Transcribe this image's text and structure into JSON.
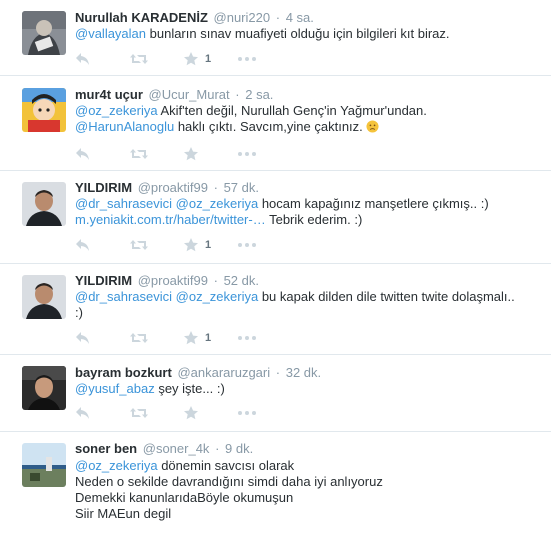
{
  "tweets": [
    {
      "fullname": "Nurullah KARADENİZ",
      "handle": "@nuri220",
      "time": "4 sa.",
      "mention1": "@vallayalan",
      "text1": " bunların sınav muafiyeti olduğu için bilgileri kıt biraz.",
      "retweet_count": "1"
    },
    {
      "fullname": "mur4t uçur",
      "handle": "@Ucur_Murat",
      "time": "2 sa.",
      "mention1": "@oz_zekeriya",
      "text1": " Akif'ten değil, Nurullah Genç'in Yağmur'undan.",
      "mention2": "@HarunAlanoglu",
      "text2": " haklı çıktı. Savcım,yine çaktınız. "
    },
    {
      "fullname": "YILDIRIM",
      "handle": "@proaktif99",
      "time": "57 dk.",
      "mention1": "@dr_sahrasevici",
      "mention2": "@oz_zekeriya",
      "text1": " hocam kapağınız manşetlere çıkmış.. :)",
      "link": "m.yeniakit.com.tr/haber/twitter-…",
      "text2": " Tebrik ederim. :)",
      "retweet_count": "1"
    },
    {
      "fullname": "YILDIRIM",
      "handle": "@proaktif99",
      "time": "52 dk.",
      "mention1": "@dr_sahrasevici",
      "mention2": "@oz_zekeriya",
      "text1": " bu kapak dilden dile twitten twite dolaşmalı..",
      "text2": ":)",
      "retweet_count": "1"
    },
    {
      "fullname": "bayram bozkurt",
      "handle": "@ankararuzgari",
      "time": "32 dk.",
      "mention1": "@yusuf_abaz",
      "text1": " şey işte... :)"
    },
    {
      "fullname": "soner ben",
      "handle": "@soner_4k",
      "time": "9 dk.",
      "mention1": "@oz_zekeriya",
      "text1": " dönemin savcısı olarak",
      "line2": "Neden o sekilde davrandığını simdi daha iyi anlıyoruz",
      "line3": "Demekki kanunlarıdaBöyle okumuşun",
      "line4": "Siir MAEun degil"
    }
  ],
  "colors": {
    "link": "#3b94d9",
    "meta": "#8899a6",
    "icon": "#ccd6dd",
    "divider": "#e1e8ed"
  },
  "icons": [
    "reply-icon",
    "retweet-icon",
    "favorite-icon",
    "more-icon",
    "emoji-worried-icon"
  ]
}
